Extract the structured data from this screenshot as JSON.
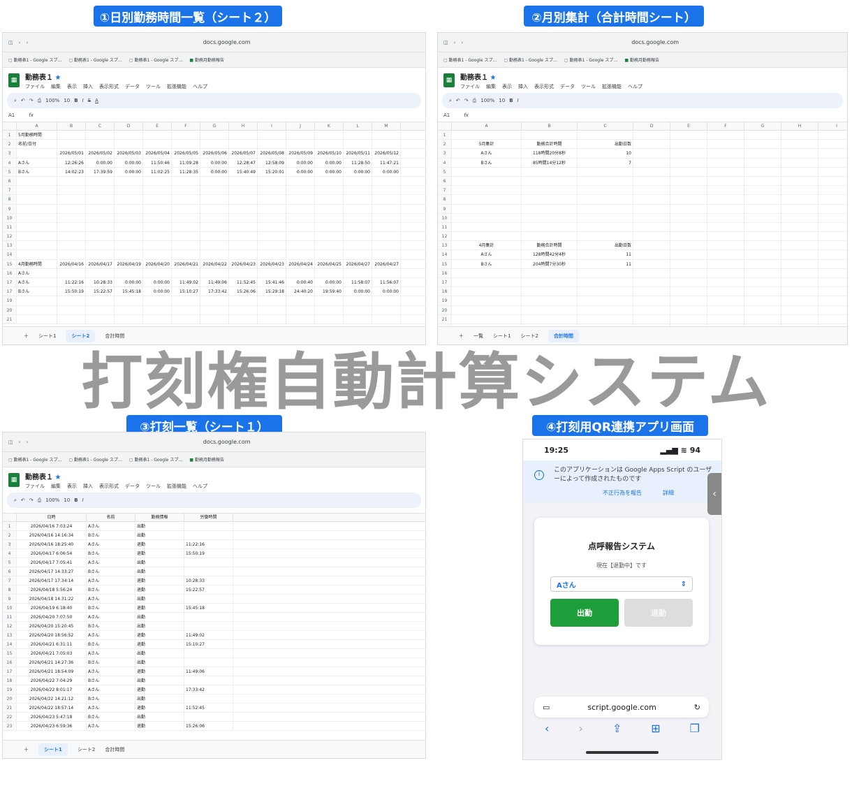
{
  "banners": {
    "b1": "①日別勤務時間一覧（シート２）",
    "b2": "②月別集計（合計時間シート）",
    "b3": "③打刻一覧（シート１）",
    "b4": "④打刻用QR連携アプリ画面"
  },
  "main_title": "打刻権自動計算システム",
  "browser": {
    "url": "docs.google.com",
    "tab1": "勤務表1 - Google スプ…",
    "tab2": "勤務表1 - Google スプ…",
    "tab3": "勤務表1 - Google スプ…",
    "tab_green": "勤務月勤務報告"
  },
  "doc": {
    "title": "勤務表１",
    "menu": [
      "ファイル",
      "編集",
      "表示",
      "挿入",
      "表示形式",
      "データ",
      "ツール",
      "拡張機能",
      "ヘルプ"
    ],
    "zoom": "100%",
    "font_size": "10",
    "cell": "A1"
  },
  "s1": {
    "cols": [
      "A",
      "B",
      "C",
      "D",
      "E",
      "F",
      "G",
      "H",
      "I",
      "J",
      "K",
      "L",
      "M"
    ],
    "rows": [
      [
        "1",
        "5月勤務時間",
        "",
        "",
        "",
        "",
        "",
        "",
        "",
        "",
        "",
        "",
        "",
        ""
      ],
      [
        "2",
        "名前/日付",
        "",
        "",
        "",
        "",
        "",
        "",
        "",
        "",
        "",
        "",
        "",
        ""
      ],
      [
        "3",
        "",
        "2026/05/01",
        "2026/05/02",
        "2026/05/03",
        "2026/05/04",
        "2026/05/05",
        "2026/05/06",
        "2026/05/07",
        "2026/05/08",
        "2026/05/09",
        "2026/05/10",
        "2026/05/11",
        "2026/05/12"
      ],
      [
        "4",
        "Aさん",
        "12:26:26",
        "0:00:00",
        "0:00:00",
        "11:50:46",
        "11:09:28",
        "0:00:00",
        "12:28:47",
        "12:58:09",
        "0:00:00",
        "0:00:00",
        "11:28:50",
        "11:47:21"
      ],
      [
        "5",
        "Bさん",
        "14:02:23",
        "17:39:59",
        "0:00:00",
        "11:02:25",
        "11:28:35",
        "0:00:00",
        "15:40:49",
        "15:20:01",
        "0:00:00",
        "0:00:00",
        "0:00:00",
        "0:00:00"
      ],
      [
        "6",
        "",
        "",
        "",
        "",
        "",
        "",
        "",
        "",
        "",
        "",
        "",
        "",
        ""
      ],
      [
        "7",
        "",
        "",
        "",
        "",
        "",
        "",
        "",
        "",
        "",
        "",
        "",
        "",
        ""
      ],
      [
        "8",
        "",
        "",
        "",
        "",
        "",
        "",
        "",
        "",
        "",
        "",
        "",
        "",
        ""
      ],
      [
        "9",
        "",
        "",
        "",
        "",
        "",
        "",
        "",
        "",
        "",
        "",
        "",
        "",
        ""
      ],
      [
        "10",
        "",
        "",
        "",
        "",
        "",
        "",
        "",
        "",
        "",
        "",
        "",
        "",
        ""
      ],
      [
        "11",
        "",
        "",
        "",
        "",
        "",
        "",
        "",
        "",
        "",
        "",
        "",
        "",
        ""
      ],
      [
        "12",
        "",
        "",
        "",
        "",
        "",
        "",
        "",
        "",
        "",
        "",
        "",
        "",
        ""
      ],
      [
        "13",
        "",
        "",
        "",
        "",
        "",
        "",
        "",
        "",
        "",
        "",
        "",
        "",
        ""
      ],
      [
        "14",
        "",
        "",
        "",
        "",
        "",
        "",
        "",
        "",
        "",
        "",
        "",
        "",
        ""
      ],
      [
        "15",
        "4月勤務時間",
        "2026/04/16",
        "2026/04/17",
        "2026/04/19",
        "2026/04/20",
        "2026/04/21",
        "2026/04/22",
        "2026/04/23",
        "2026/04/23",
        "2026/04/24",
        "2026/04/25",
        "2026/04/27",
        "2026/04/27"
      ],
      [
        "16",
        "Aさん",
        "",
        "",
        "",
        "",
        "",
        "",
        "",
        "",
        "",
        "",
        "",
        ""
      ],
      [
        "17",
        "Aさん",
        "11:22:16",
        "10:28:33",
        "0:00:00",
        "0:00:00",
        "11:49:02",
        "11:49:06",
        "11:52:45",
        "15:41:46",
        "0:00:40",
        "0:00:00",
        "11:58:07",
        "11:56:07"
      ],
      [
        "17",
        "Bさん",
        "15:50:19",
        "15:22:57",
        "15:45:18",
        "0:00:00",
        "15:10:27",
        "17:33:42",
        "15:26:06",
        "15:29:18",
        "24:40:20",
        "19:59:40",
        "0:00:00",
        "0:00:00"
      ],
      [
        "19",
        "",
        "",
        "",
        "",
        "",
        "",
        "",
        "",
        "",
        "",
        "",
        "",
        ""
      ],
      [
        "20",
        "",
        "",
        "",
        "",
        "",
        "",
        "",
        "",
        "",
        "",
        "",
        "",
        ""
      ],
      [
        "21",
        "",
        "",
        "",
        "",
        "",
        "",
        "",
        "",
        "",
        "",
        "",
        "",
        ""
      ]
    ]
  },
  "s2": {
    "cols": [
      "A",
      "B",
      "C",
      "D",
      "E",
      "F",
      "G",
      "H",
      "I",
      "J"
    ],
    "rows": [
      [
        "1",
        "",
        "",
        ""
      ],
      [
        "2",
        "5月集計",
        "勤務合計時間",
        "出勤日数"
      ],
      [
        "3",
        "Aさん",
        "118時間20分8秒",
        "10"
      ],
      [
        "4",
        "Bさん",
        "85時間14分12秒",
        "7"
      ],
      [
        "5",
        "",
        "",
        ""
      ],
      [
        "6",
        "",
        "",
        ""
      ],
      [
        "7",
        "",
        "",
        ""
      ],
      [
        "8",
        "",
        "",
        ""
      ],
      [
        "9",
        "",
        "",
        ""
      ],
      [
        "10",
        "",
        "",
        ""
      ],
      [
        "11",
        "",
        "",
        ""
      ],
      [
        "12",
        "",
        "",
        ""
      ],
      [
        "13",
        "4月集計",
        "勤務合計時間",
        "出勤日数"
      ],
      [
        "14",
        "Aさん",
        "128時間42分4秒",
        "11"
      ],
      [
        "15",
        "Bさん",
        "204時間7分30秒",
        "11"
      ],
      [
        "16",
        "",
        "",
        ""
      ],
      [
        "17",
        "",
        "",
        ""
      ],
      [
        "18",
        "",
        "",
        ""
      ],
      [
        "19",
        "",
        "",
        ""
      ],
      [
        "20",
        "",
        "",
        ""
      ],
      [
        "21",
        "",
        "",
        ""
      ],
      [
        "22",
        "",
        "",
        ""
      ]
    ]
  },
  "s3": {
    "headers": [
      "日時",
      "名前",
      "勤務情報",
      "労働時間"
    ],
    "rows": [
      [
        "1",
        "2026/04/16 7:03:24",
        "Aさん",
        "出勤",
        ""
      ],
      [
        "2",
        "2026/04/16 14:16:34",
        "Bさん",
        "出勤",
        ""
      ],
      [
        "3",
        "2026/04/16 18:25:40",
        "Aさん",
        "退勤",
        "11:22:16"
      ],
      [
        "4",
        "2026/04/17 6:06:54",
        "Bさん",
        "退勤",
        "15:50:19"
      ],
      [
        "5",
        "2026/04/17 7:05:41",
        "Aさん",
        "出勤",
        ""
      ],
      [
        "6",
        "2026/04/17 14:33:27",
        "Bさん",
        "出勤",
        ""
      ],
      [
        "7",
        "2026/04/17 17:34:14",
        "Aさん",
        "退勤",
        "10:28:33"
      ],
      [
        "8",
        "2026/04/18 5:56:24",
        "Bさん",
        "退勤",
        "15:22:57"
      ],
      [
        "9",
        "2026/04/18 14:31:22",
        "Aさん",
        "出勤",
        ""
      ],
      [
        "10",
        "2026/04/19 6:18:40",
        "Bさん",
        "退勤",
        "15:45:18"
      ],
      [
        "11",
        "2026/04/20 7:07:50",
        "Aさん",
        "出勤",
        ""
      ],
      [
        "12",
        "2026/04/20 15:20:45",
        "Bさん",
        "出勤",
        ""
      ],
      [
        "13",
        "2026/04/20 18:56:52",
        "Aさん",
        "退勤",
        "11:49:02"
      ],
      [
        "14",
        "2026/04/21 6:31:11",
        "Bさん",
        "退勤",
        "15:10:27"
      ],
      [
        "15",
        "2026/04/21 7:05:03",
        "Aさん",
        "出勤",
        ""
      ],
      [
        "16",
        "2026/04/21 14:27:36",
        "Bさん",
        "出勤",
        ""
      ],
      [
        "17",
        "2026/04/21 18:54:09",
        "Aさん",
        "退勤",
        "11:49:06"
      ],
      [
        "18",
        "2026/04/22 7:04:29",
        "Bさん",
        "出勤",
        ""
      ],
      [
        "19",
        "2026/04/22 8:01:17",
        "Aさん",
        "退勤",
        "17:33:42"
      ],
      [
        "20",
        "2026/04/22 14:21:12",
        "Bさん",
        "出勤",
        ""
      ],
      [
        "21",
        "2026/04/22 18:57:14",
        "Aさん",
        "退勤",
        "11:52:45"
      ],
      [
        "22",
        "2026/04/23 5:47:18",
        "Bさん",
        "出勤",
        ""
      ],
      [
        "23",
        "2026/04/23 6:59:36",
        "Aさん",
        "退勤",
        "15:26:06"
      ]
    ]
  },
  "sheet_tabs": {
    "t1": "シート1",
    "t2": "シート2",
    "t3": "合計時間",
    "t0": "一覧"
  },
  "phone": {
    "time": "19:25",
    "battery": "94",
    "notice": "このアプリケーションは Google Apps Script のユーザーによって作成されたものです",
    "report": "不正行為を報告",
    "details": "詳細",
    "card_title": "点呼報告システム",
    "status": "現在【退勤中】です",
    "select_value": "Aさん",
    "btn_in": "出勤",
    "btn_out": "退勤",
    "url": "script.google.com"
  }
}
